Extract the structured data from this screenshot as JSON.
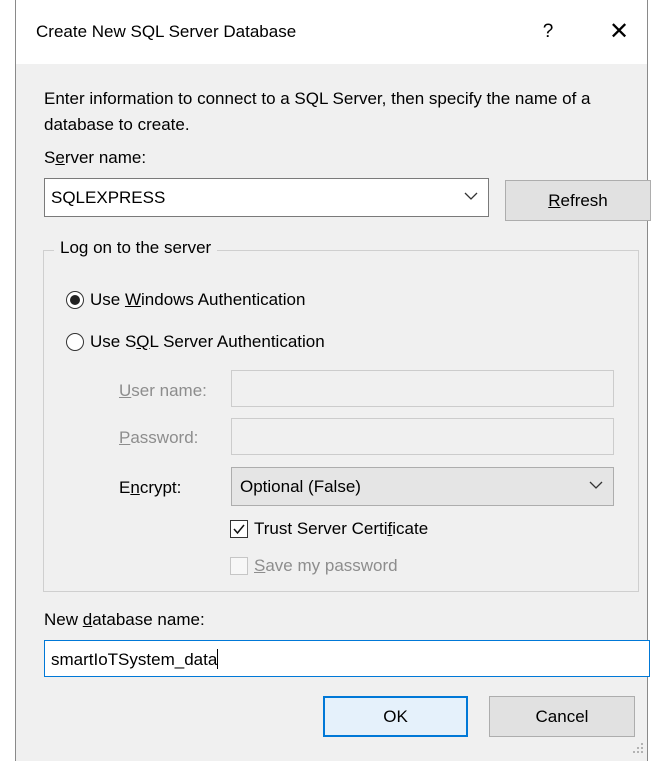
{
  "window": {
    "title": "Create New SQL Server Database",
    "help_label": "?",
    "close_label": "✕"
  },
  "instructions": "Enter information to connect to a SQL Server, then specify the name of a database to create.",
  "server": {
    "label_pre": "S",
    "label_u": "e",
    "label_post": "rver name:",
    "value": "SQLEXPRESS",
    "refresh_u": "R",
    "refresh_rest": "efresh"
  },
  "logon": {
    "legend": "Log on to the server",
    "windows_auth": {
      "pre": "Use ",
      "u": "W",
      "post": "indows Authentication",
      "selected": true
    },
    "sql_auth": {
      "pre": "Use S",
      "u": "Q",
      "post": "L Server Authentication",
      "selected": false
    },
    "username_label": {
      "u": "U",
      "post": "ser name:"
    },
    "username_value": "",
    "password_label": {
      "u": "P",
      "post": "assword:"
    },
    "password_value": "",
    "encrypt_label": {
      "pre": "E",
      "u": "n",
      "post": "crypt:"
    },
    "encrypt_value": "Optional (False)",
    "trust_cert": {
      "pre": "Trust Server Certi",
      "u": "f",
      "post": "icate",
      "checked": true
    },
    "save_password": {
      "u": "S",
      "post": "ave my password",
      "checked": false
    }
  },
  "database": {
    "label_pre": "New ",
    "label_u": "d",
    "label_post": "atabase name:",
    "value": "smartIoTSystem_data"
  },
  "buttons": {
    "ok": "OK",
    "cancel": "Cancel"
  },
  "colors": {
    "accent": "#0078d7",
    "dialog_bg": "#f0f0f0",
    "disabled_text": "#8d8d8d"
  }
}
